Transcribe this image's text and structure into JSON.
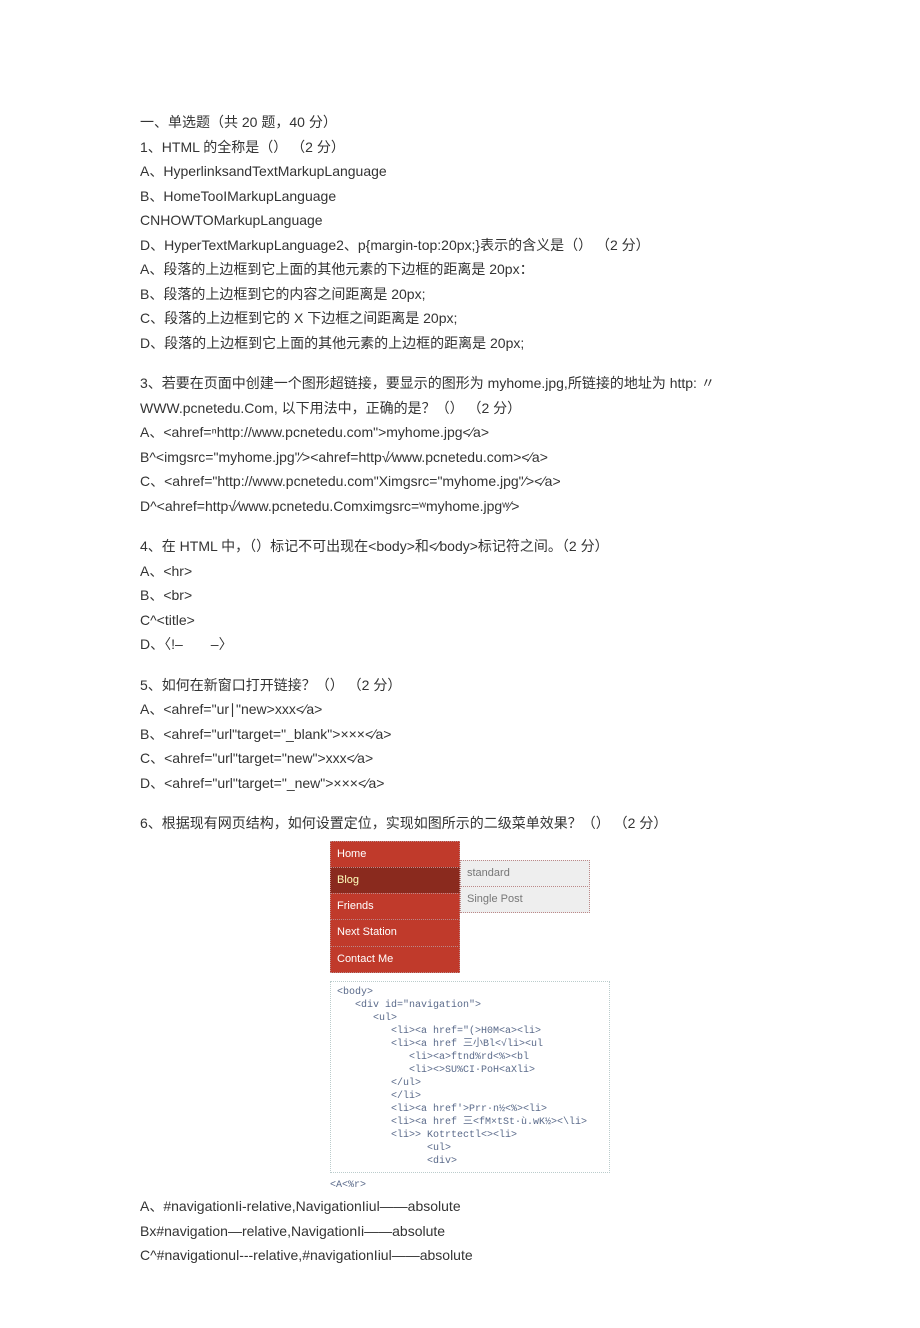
{
  "section_title": "一、单选题（共 20 题，40 分）",
  "q1": {
    "stem": "1、HTML 的全称是（） （2 分）",
    "a": "A、HyperlinksandTextMarkupLanguage",
    "b": "B、HomeTooIMarkupLanguage",
    "c": "CNHOWTOMarkupLanguage",
    "d": "D、HyperTextMarkupLanguage2、p{margin-top:20px;}表示的含义是（） （2 分）"
  },
  "q2": {
    "a": "A、段落的上边框到它上面的其他元素的下边框的距离是 20px：",
    "b": "B、段落的上边框到它的内容之间距离是 20px;",
    "c": "C、段落的上边框到它的 X 下边框之间距离是 20px;",
    "d": "D、段落的上边框到它上面的其他元素的上边框的距离是 20px;"
  },
  "q3": {
    "stem1": "3、若要在页面中创建一个图形超链接，要显示的图形为 myhome.jpg,所链接的地址为 http: 〃",
    "stem2": "WWW.pcnetedu.Com, 以下用法中，正确的是？（） （2 分）",
    "a": "A、<ahref=ⁿhttp://www.pcnetedu.com\">myhome.jpg<∕a>",
    "b": "B^<imgsrc=\"myhome.jpg\"∕><ahref=http√∕www.pcnetedu.com><∕a>",
    "c": "C、<ahref=\"http://www.pcnetedu.com\"Ximgsrc=\"myhome.jpg\"∕><∕a>",
    "d": "D^<ahref=http√∕www.pcnetedu.Comximgsrc=ʷmyhome.jpgʷ∕>"
  },
  "q4": {
    "stem": "4、在 HTML 中，（）标记不可出现在<body>和<∕body>标记符之间。（2 分）",
    "a": "A、<hr>",
    "b": "B、<br>",
    "c": "C^<title>",
    "d": "D、〈!–　　–〉"
  },
  "q5": {
    "stem": "5、如何在新窗口打开链接？（） （2 分）",
    "a": "A、<ahref=\"ur∣\"new>xxx<∕a>",
    "b": "B、<ahref=\"url\"target=\"_blank\">×××<∕a>",
    "c": "C、<ahref=\"url\"target=\"new\">xxx<∕a>",
    "d": "D、<ahref=\"url\"target=\"_new\">×××<∕a>"
  },
  "q6": {
    "stem": "6、根据现有网页结构，如何设置定位，实现如图所示的二级菜单效果？（） （2 分）",
    "menu_left": [
      "Home",
      "Blog",
      "Friends",
      "Next Station",
      "Contact Me"
    ],
    "menu_right": [
      "standard",
      "Single Post"
    ],
    "code0": "<body>",
    "code1": "<div id=\"navigation\">",
    "code2": "<ul>",
    "code3": "<li><a href=\"(>H0M<a><li>",
    "code4a": "<li><a href 三小Bl<√li><ul",
    "code4b": "<li><a>ftnd%rd<%><bl",
    "code4c": "<li><>SU%CI·PoH<aXli>",
    "code4d": "</ul>",
    "code5": "</li>",
    "code6a": "<li><a href'>Prr∙n½<%><li>",
    "code6b": "<li><a href 三<fM×tSt·ù.wK½><\\li>",
    "code6c": "<li>>        Kotrtectl<><li>",
    "code6d": "<ul>",
    "code6e": "<div>",
    "code_out": "<A<%r>",
    "a": "A、#navigationIi-relative,NavigationIiul——absolute",
    "b": "Bx#navigation—relative,NavigationIi——absolute",
    "c": "C^#navigationul---relative,#navigationIiul——absolute"
  }
}
